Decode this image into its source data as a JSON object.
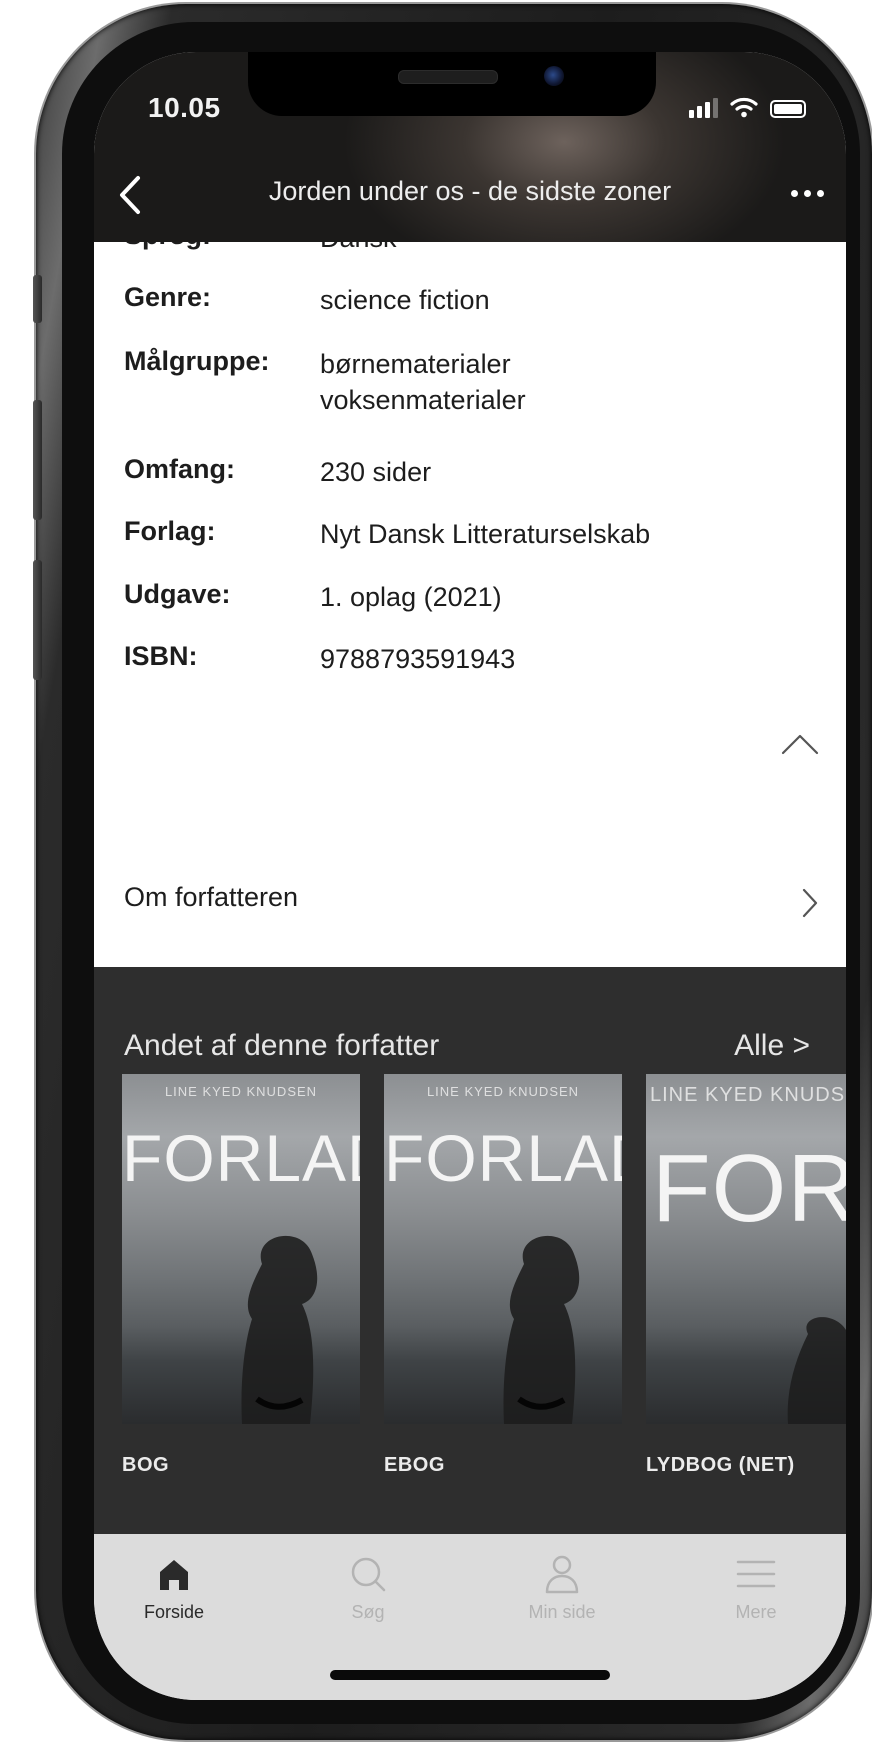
{
  "status_bar": {
    "time": "10.05"
  },
  "header": {
    "title": "Jorden under os - de sidste zoner"
  },
  "details": [
    {
      "label": "Sprog:",
      "values": [
        "Dansk"
      ]
    },
    {
      "label": "Genre:",
      "values": [
        "science fiction"
      ]
    },
    {
      "label": "Målgruppe:",
      "values": [
        "børnematerialer",
        "voksenmaterialer"
      ]
    },
    {
      "label": "Omfang:",
      "values": [
        "230 sider"
      ]
    },
    {
      "label": "Forlag:",
      "values": [
        "Nyt Dansk Litteraturselskab"
      ]
    },
    {
      "label": "Udgave:",
      "values": [
        "1. oplag (2021)"
      ]
    },
    {
      "label": "ISBN:",
      "values": [
        "9788793591943"
      ]
    }
  ],
  "author_section": {
    "label": "Om forfatteren"
  },
  "more_by_author": {
    "title": "Andet af denne forfatter",
    "all_label": "Alle >",
    "items": [
      {
        "cover_author": "LINE KYED KNUDSEN",
        "cover_title": "FORLADT",
        "format": "BOG"
      },
      {
        "cover_author": "LINE KYED KNUDSEN",
        "cover_title": "FORLADT",
        "format": "EBOG"
      },
      {
        "cover_author": "LINE KYED KNUDS",
        "cover_title": "FORLA",
        "format": "LYDBOG (NET)"
      }
    ]
  },
  "tabbar": {
    "tabs": [
      {
        "label": "Forside",
        "icon": "home-icon",
        "active": true
      },
      {
        "label": "Søg",
        "icon": "search-icon",
        "active": false
      },
      {
        "label": "Min side",
        "icon": "person-icon",
        "active": false
      },
      {
        "label": "Mere",
        "icon": "menu-icon",
        "active": false
      }
    ]
  },
  "colors": {
    "header_bg": "#1b1a19",
    "section_bg": "#2e2e2e",
    "tabbar_bg": "#dcdcdc",
    "active_tab": "#2a2a2a",
    "inactive_tab": "#b3b3b3"
  }
}
